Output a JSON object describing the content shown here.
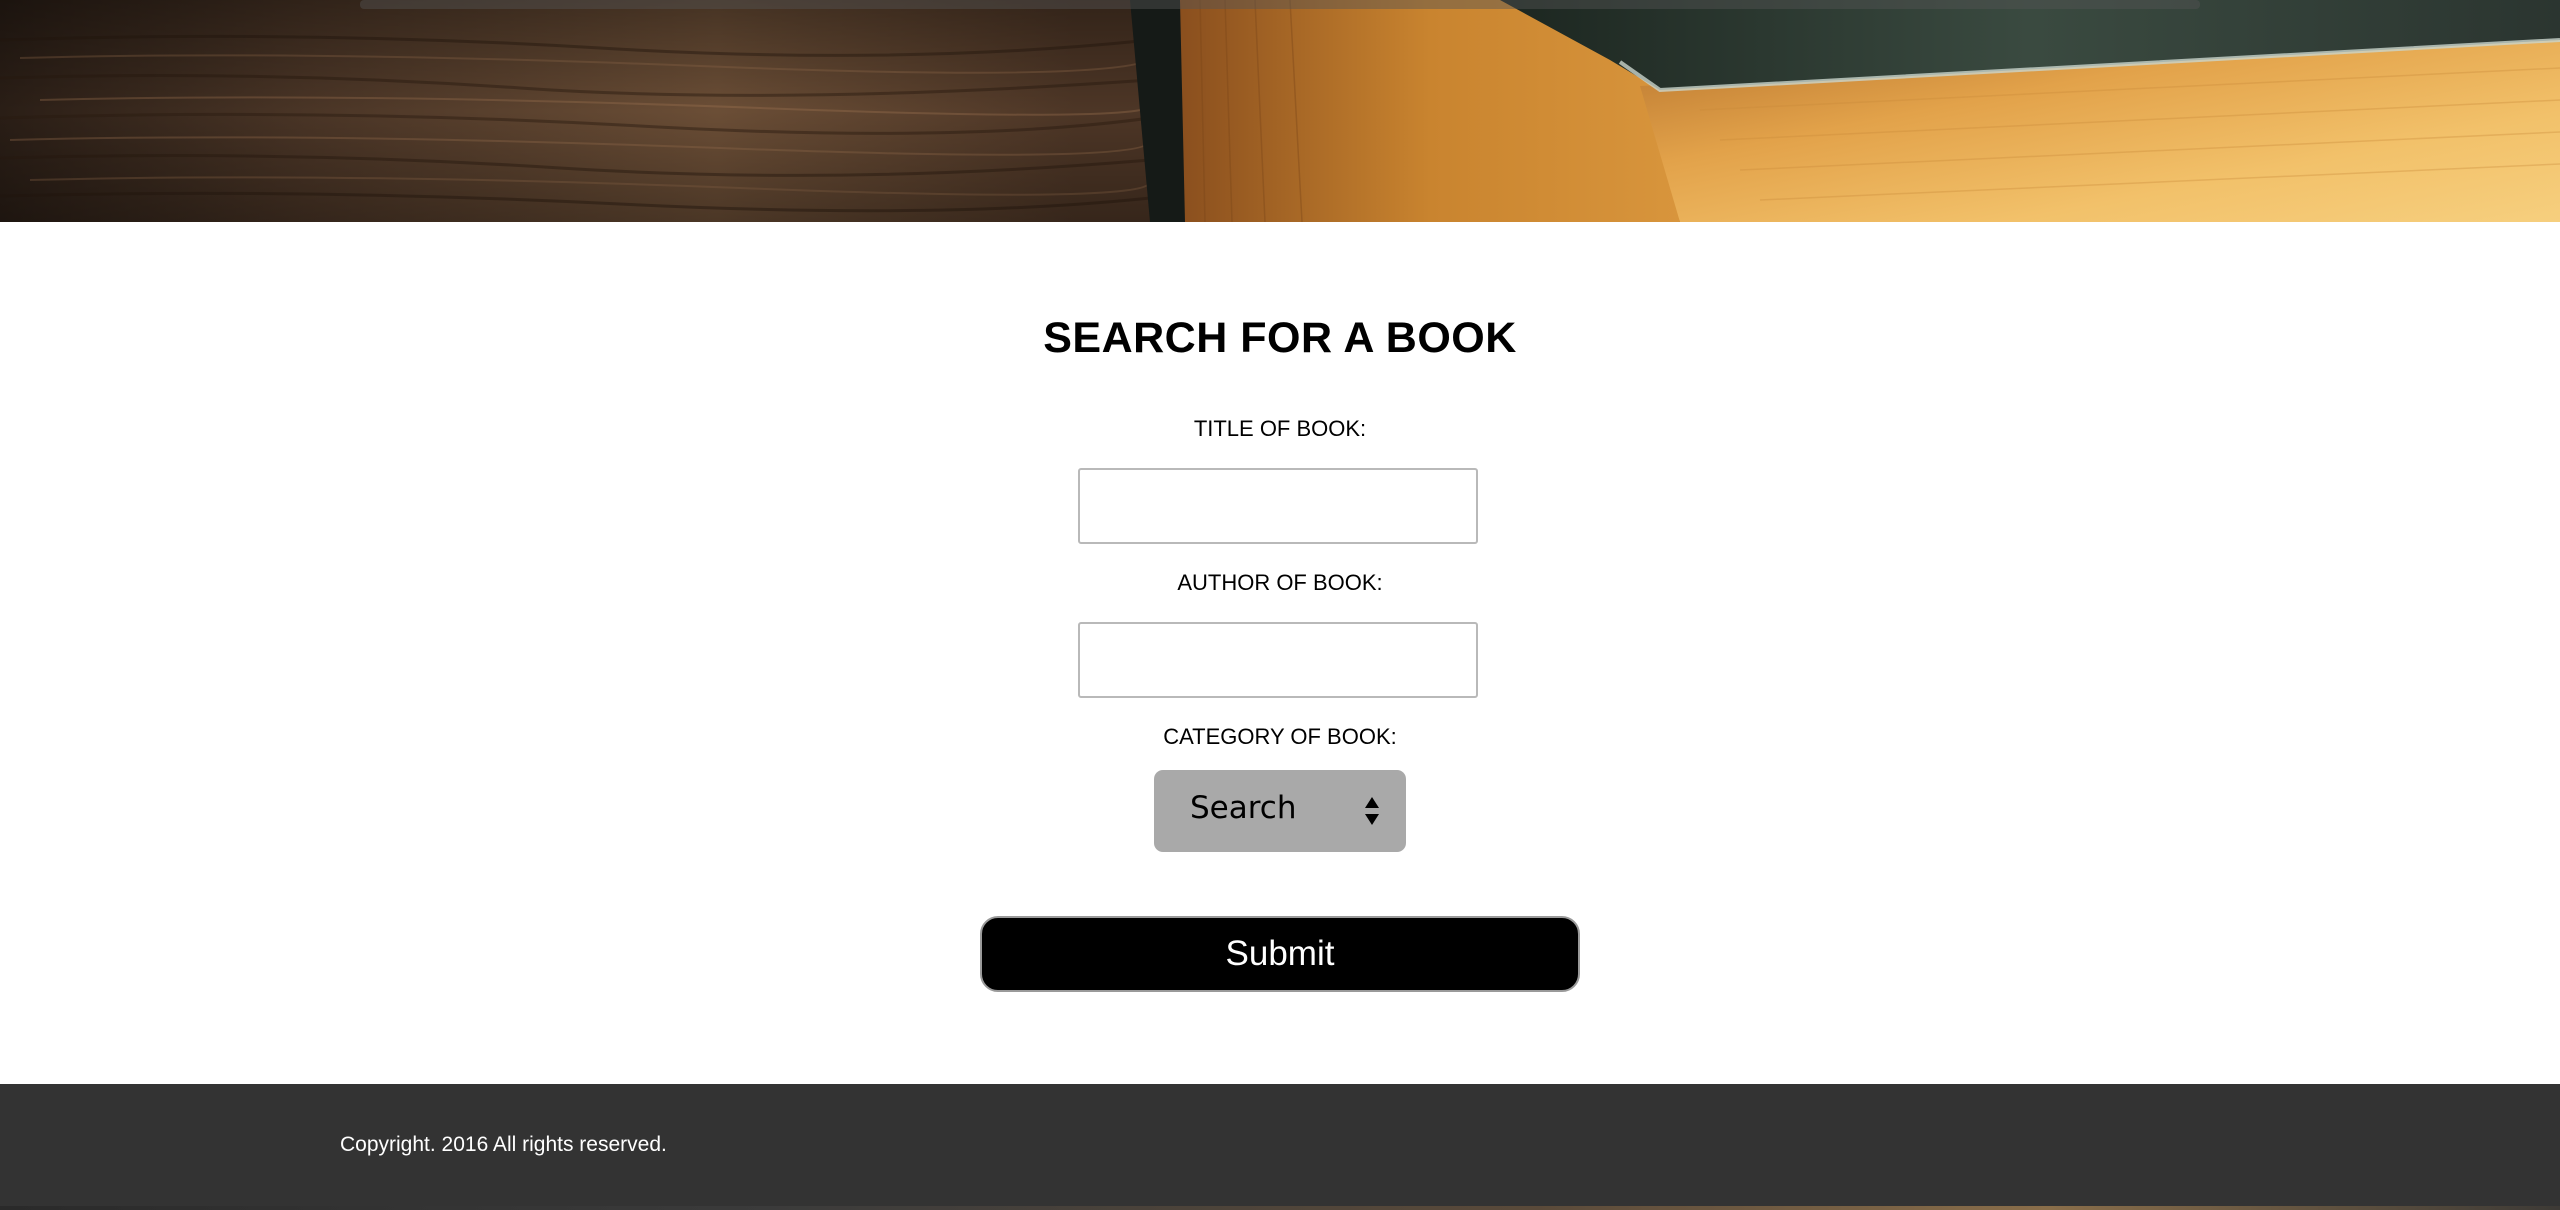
{
  "hero": {
    "image": "book-on-wooden-table"
  },
  "form": {
    "title": "SEARCH FOR A BOOK",
    "fields": [
      {
        "label": "TITLE OF BOOK:",
        "value": ""
      },
      {
        "label": "AUTHOR OF BOOK:",
        "value": ""
      }
    ],
    "category": {
      "label": "CATEGORY OF BOOK:",
      "selected": "Search",
      "icon": "select-arrows-icon"
    },
    "submit_label": "Submit"
  },
  "footer": {
    "copyright": "Copyright. 2016 All rights reserved."
  },
  "colors": {
    "footer_bg": "#333333",
    "select_bg": "#a9a9a9",
    "button_bg": "#000000"
  }
}
